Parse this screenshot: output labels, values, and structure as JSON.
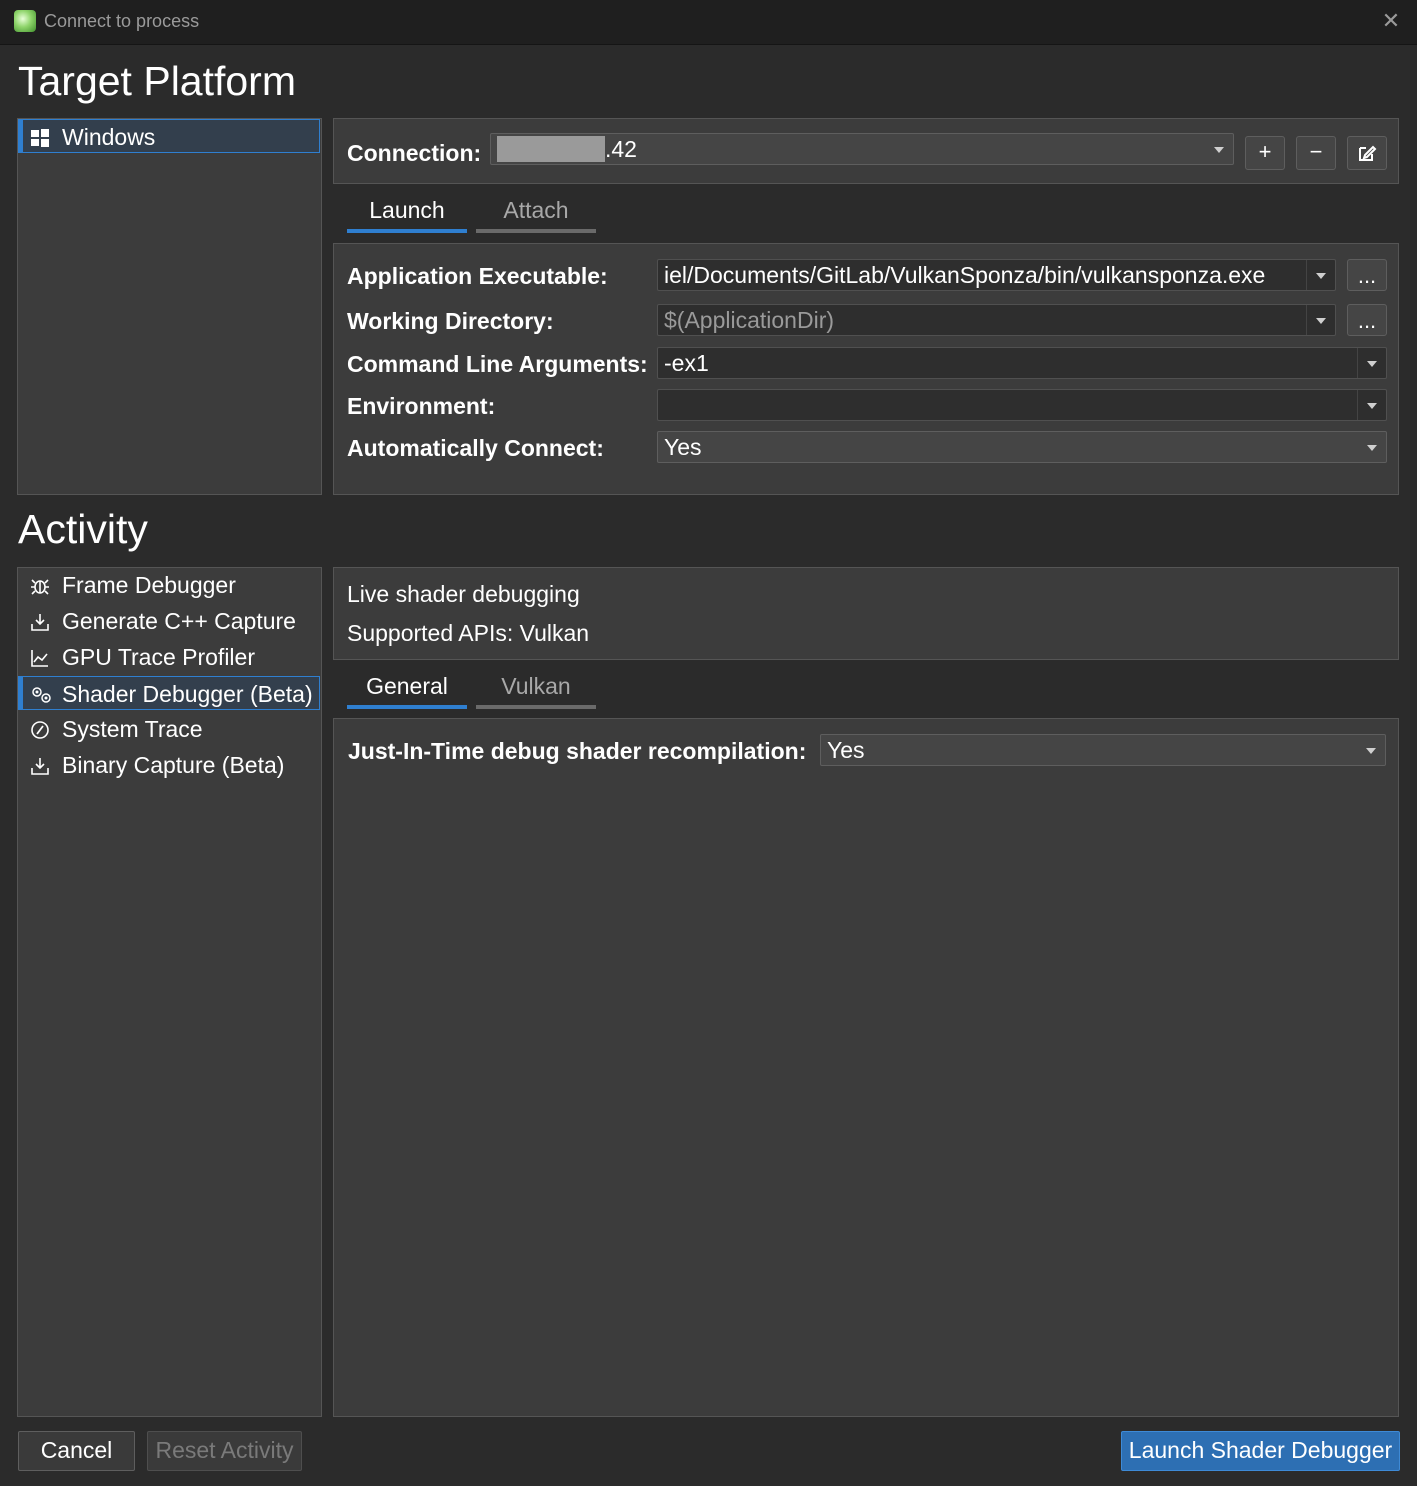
{
  "window": {
    "title": "Connect to process"
  },
  "target_platform": {
    "heading": "Target Platform",
    "platforms": [
      {
        "label": "Windows",
        "icon": "windows-icon",
        "selected": true
      }
    ]
  },
  "connection": {
    "label": "Connection:",
    "value": ".42",
    "add_label": "+",
    "remove_label": "−"
  },
  "launch_tabs": [
    {
      "label": "Launch",
      "active": true
    },
    {
      "label": "Attach",
      "active": false
    }
  ],
  "launch_form": {
    "app_exe_label": "Application Executable:",
    "app_exe_value": "iel/Documents/GitLab/VulkanSponza/bin/vulkansponza.exe",
    "working_dir_label": "Working Directory:",
    "working_dir_value": "$(ApplicationDir)",
    "cmd_args_label": "Command Line Arguments:",
    "cmd_args_value": "-ex1",
    "env_label": "Environment:",
    "env_value": "",
    "auto_connect_label": "Automatically Connect:",
    "auto_connect_value": "Yes",
    "browse_label": "..."
  },
  "activity": {
    "heading": "Activity",
    "items": [
      {
        "label": "Frame Debugger",
        "icon": "bug-icon"
      },
      {
        "label": "Generate C++ Capture",
        "icon": "download-icon"
      },
      {
        "label": "GPU Trace Profiler",
        "icon": "chart-icon"
      },
      {
        "label": "Shader Debugger (Beta)",
        "icon": "gears-icon",
        "selected": true
      },
      {
        "label": "System Trace",
        "icon": "gauge-icon"
      },
      {
        "label": "Binary Capture (Beta)",
        "icon": "download-icon"
      }
    ],
    "description_line1": "Live shader debugging",
    "description_line2": "Supported APIs: Vulkan"
  },
  "activity_tabs": [
    {
      "label": "General",
      "active": true
    },
    {
      "label": "Vulkan",
      "active": false
    }
  ],
  "general": {
    "jit_label": "Just-In-Time debug shader recompilation:",
    "jit_value": "Yes"
  },
  "footer": {
    "cancel": "Cancel",
    "reset": "Reset Activity",
    "launch": "Launch Shader Debugger"
  },
  "colors": {
    "accent": "#2f7fd0",
    "primary_button": "#2d6fb3",
    "background": "#2b2b2b",
    "panel": "#3c3c3c"
  }
}
